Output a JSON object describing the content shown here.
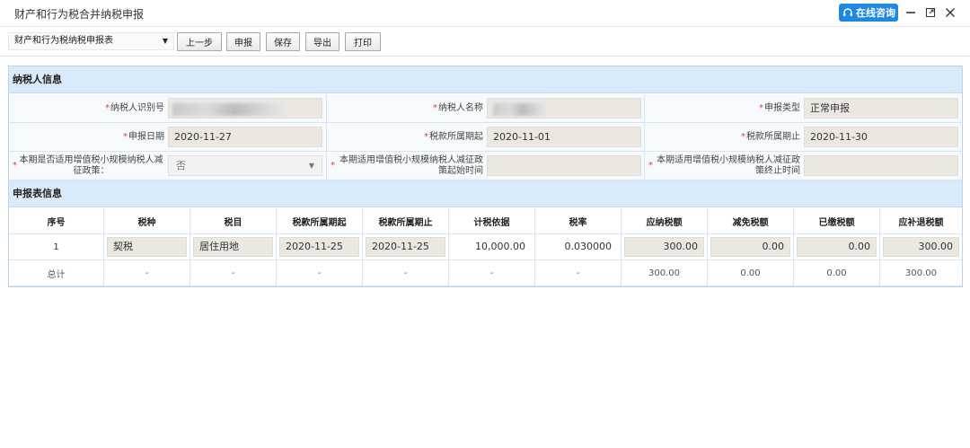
{
  "window": {
    "title": "财产和行为税合并纳税申报",
    "consult_label": "在线咨询"
  },
  "toolbar": {
    "table_select": "财产和行为税纳税申报表",
    "buttons": [
      "上一步",
      "申报",
      "保存",
      "导出",
      "打印"
    ]
  },
  "taxpayer_info": {
    "section_title": "纳税人信息",
    "taxpayer_id_label": "纳税人识别号",
    "taxpayer_name_label": "纳税人名称",
    "declare_type_label": "申报类型",
    "declare_type_value": "正常申报",
    "declare_date_label": "申报日期",
    "declare_date_value": "2020-11-27",
    "period_start_label": "税款所属期起",
    "period_start_value": "2020-11-01",
    "period_end_label": "税款所属期止",
    "period_end_value": "2020-11-30",
    "small_scale_label": "本期是否适用增值税小规模纳税人减征政策：",
    "small_scale_value": "否",
    "policy_start_label": "本期适用增值税小规模纳税人减征政策起始时间",
    "policy_end_label": "本期适用增值税小规模纳税人减征政策终止时间"
  },
  "declaration_table": {
    "section_title": "申报表信息",
    "headers": [
      "序号",
      "税种",
      "税目",
      "税款所属期起",
      "税款所属期止",
      "计税依据",
      "税率",
      "应纳税额",
      "减免税额",
      "已缴税额",
      "应补退税额"
    ],
    "rows": [
      [
        "1",
        "契税",
        "居住用地",
        "2020-11-25",
        "2020-11-25",
        "10,000.00",
        "0.030000",
        "300.00",
        "0.00",
        "0.00",
        "300.00"
      ]
    ],
    "total": [
      "总计",
      "-",
      "-",
      "-",
      "-",
      "-",
      "-",
      "300.00",
      "0.00",
      "0.00",
      "300.00"
    ]
  }
}
